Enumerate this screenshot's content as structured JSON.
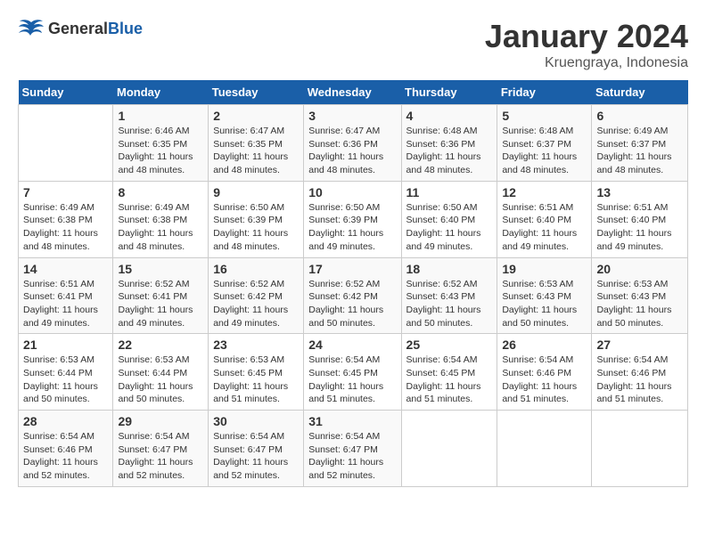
{
  "header": {
    "logo_general": "General",
    "logo_blue": "Blue",
    "month": "January 2024",
    "location": "Kruengraya, Indonesia"
  },
  "weekdays": [
    "Sunday",
    "Monday",
    "Tuesday",
    "Wednesday",
    "Thursday",
    "Friday",
    "Saturday"
  ],
  "weeks": [
    [
      {
        "day": "",
        "sunrise": "",
        "sunset": "",
        "daylight": ""
      },
      {
        "day": "1",
        "sunrise": "Sunrise: 6:46 AM",
        "sunset": "Sunset: 6:35 PM",
        "daylight": "Daylight: 11 hours and 48 minutes."
      },
      {
        "day": "2",
        "sunrise": "Sunrise: 6:47 AM",
        "sunset": "Sunset: 6:35 PM",
        "daylight": "Daylight: 11 hours and 48 minutes."
      },
      {
        "day": "3",
        "sunrise": "Sunrise: 6:47 AM",
        "sunset": "Sunset: 6:36 PM",
        "daylight": "Daylight: 11 hours and 48 minutes."
      },
      {
        "day": "4",
        "sunrise": "Sunrise: 6:48 AM",
        "sunset": "Sunset: 6:36 PM",
        "daylight": "Daylight: 11 hours and 48 minutes."
      },
      {
        "day": "5",
        "sunrise": "Sunrise: 6:48 AM",
        "sunset": "Sunset: 6:37 PM",
        "daylight": "Daylight: 11 hours and 48 minutes."
      },
      {
        "day": "6",
        "sunrise": "Sunrise: 6:49 AM",
        "sunset": "Sunset: 6:37 PM",
        "daylight": "Daylight: 11 hours and 48 minutes."
      }
    ],
    [
      {
        "day": "7",
        "sunrise": "Sunrise: 6:49 AM",
        "sunset": "Sunset: 6:38 PM",
        "daylight": "Daylight: 11 hours and 48 minutes."
      },
      {
        "day": "8",
        "sunrise": "Sunrise: 6:49 AM",
        "sunset": "Sunset: 6:38 PM",
        "daylight": "Daylight: 11 hours and 48 minutes."
      },
      {
        "day": "9",
        "sunrise": "Sunrise: 6:50 AM",
        "sunset": "Sunset: 6:39 PM",
        "daylight": "Daylight: 11 hours and 48 minutes."
      },
      {
        "day": "10",
        "sunrise": "Sunrise: 6:50 AM",
        "sunset": "Sunset: 6:39 PM",
        "daylight": "Daylight: 11 hours and 49 minutes."
      },
      {
        "day": "11",
        "sunrise": "Sunrise: 6:50 AM",
        "sunset": "Sunset: 6:40 PM",
        "daylight": "Daylight: 11 hours and 49 minutes."
      },
      {
        "day": "12",
        "sunrise": "Sunrise: 6:51 AM",
        "sunset": "Sunset: 6:40 PM",
        "daylight": "Daylight: 11 hours and 49 minutes."
      },
      {
        "day": "13",
        "sunrise": "Sunrise: 6:51 AM",
        "sunset": "Sunset: 6:40 PM",
        "daylight": "Daylight: 11 hours and 49 minutes."
      }
    ],
    [
      {
        "day": "14",
        "sunrise": "Sunrise: 6:51 AM",
        "sunset": "Sunset: 6:41 PM",
        "daylight": "Daylight: 11 hours and 49 minutes."
      },
      {
        "day": "15",
        "sunrise": "Sunrise: 6:52 AM",
        "sunset": "Sunset: 6:41 PM",
        "daylight": "Daylight: 11 hours and 49 minutes."
      },
      {
        "day": "16",
        "sunrise": "Sunrise: 6:52 AM",
        "sunset": "Sunset: 6:42 PM",
        "daylight": "Daylight: 11 hours and 49 minutes."
      },
      {
        "day": "17",
        "sunrise": "Sunrise: 6:52 AM",
        "sunset": "Sunset: 6:42 PM",
        "daylight": "Daylight: 11 hours and 50 minutes."
      },
      {
        "day": "18",
        "sunrise": "Sunrise: 6:52 AM",
        "sunset": "Sunset: 6:43 PM",
        "daylight": "Daylight: 11 hours and 50 minutes."
      },
      {
        "day": "19",
        "sunrise": "Sunrise: 6:53 AM",
        "sunset": "Sunset: 6:43 PM",
        "daylight": "Daylight: 11 hours and 50 minutes."
      },
      {
        "day": "20",
        "sunrise": "Sunrise: 6:53 AM",
        "sunset": "Sunset: 6:43 PM",
        "daylight": "Daylight: 11 hours and 50 minutes."
      }
    ],
    [
      {
        "day": "21",
        "sunrise": "Sunrise: 6:53 AM",
        "sunset": "Sunset: 6:44 PM",
        "daylight": "Daylight: 11 hours and 50 minutes."
      },
      {
        "day": "22",
        "sunrise": "Sunrise: 6:53 AM",
        "sunset": "Sunset: 6:44 PM",
        "daylight": "Daylight: 11 hours and 50 minutes."
      },
      {
        "day": "23",
        "sunrise": "Sunrise: 6:53 AM",
        "sunset": "Sunset: 6:45 PM",
        "daylight": "Daylight: 11 hours and 51 minutes."
      },
      {
        "day": "24",
        "sunrise": "Sunrise: 6:54 AM",
        "sunset": "Sunset: 6:45 PM",
        "daylight": "Daylight: 11 hours and 51 minutes."
      },
      {
        "day": "25",
        "sunrise": "Sunrise: 6:54 AM",
        "sunset": "Sunset: 6:45 PM",
        "daylight": "Daylight: 11 hours and 51 minutes."
      },
      {
        "day": "26",
        "sunrise": "Sunrise: 6:54 AM",
        "sunset": "Sunset: 6:46 PM",
        "daylight": "Daylight: 11 hours and 51 minutes."
      },
      {
        "day": "27",
        "sunrise": "Sunrise: 6:54 AM",
        "sunset": "Sunset: 6:46 PM",
        "daylight": "Daylight: 11 hours and 51 minutes."
      }
    ],
    [
      {
        "day": "28",
        "sunrise": "Sunrise: 6:54 AM",
        "sunset": "Sunset: 6:46 PM",
        "daylight": "Daylight: 11 hours and 52 minutes."
      },
      {
        "day": "29",
        "sunrise": "Sunrise: 6:54 AM",
        "sunset": "Sunset: 6:47 PM",
        "daylight": "Daylight: 11 hours and 52 minutes."
      },
      {
        "day": "30",
        "sunrise": "Sunrise: 6:54 AM",
        "sunset": "Sunset: 6:47 PM",
        "daylight": "Daylight: 11 hours and 52 minutes."
      },
      {
        "day": "31",
        "sunrise": "Sunrise: 6:54 AM",
        "sunset": "Sunset: 6:47 PM",
        "daylight": "Daylight: 11 hours and 52 minutes."
      },
      {
        "day": "",
        "sunrise": "",
        "sunset": "",
        "daylight": ""
      },
      {
        "day": "",
        "sunrise": "",
        "sunset": "",
        "daylight": ""
      },
      {
        "day": "",
        "sunrise": "",
        "sunset": "",
        "daylight": ""
      }
    ]
  ]
}
